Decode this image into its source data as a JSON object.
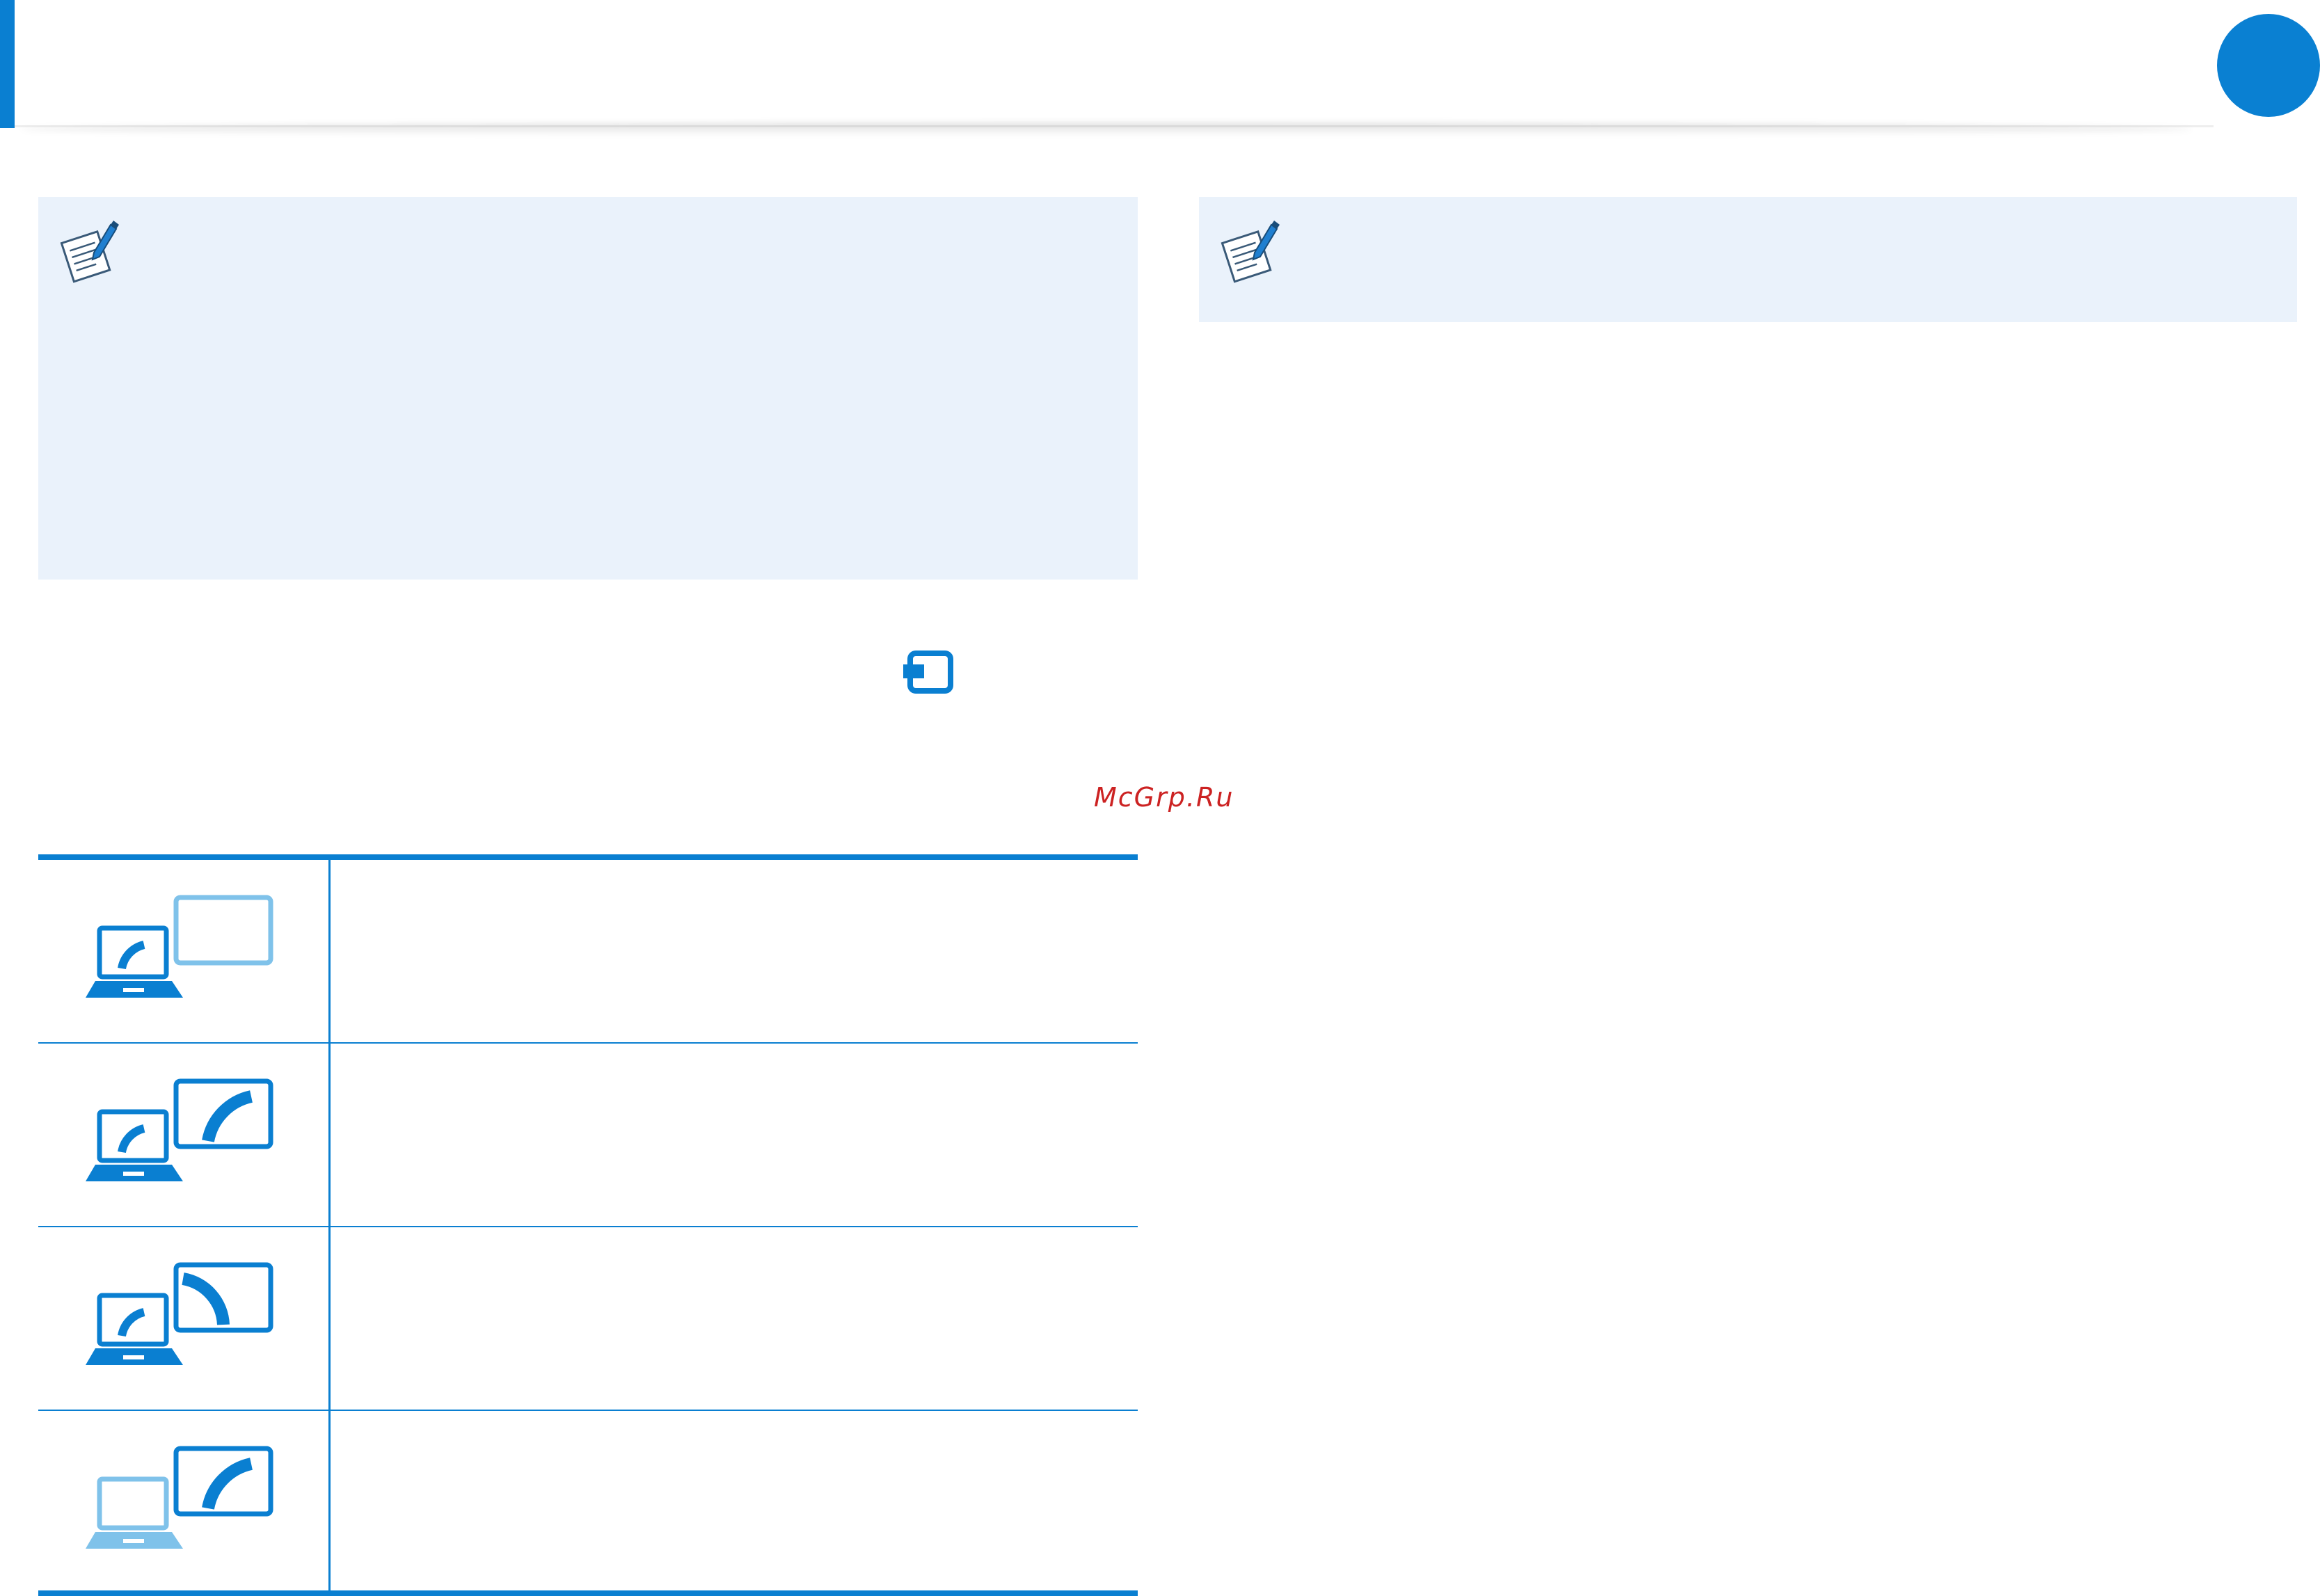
{
  "header": {
    "accent_color": "#0a7fd1",
    "chapter_badge_color": "#0a80d2"
  },
  "notes": [
    {
      "icon": "note-pencil-icon"
    },
    {
      "icon": "note-pencil-icon"
    }
  ],
  "inline_icons": {
    "display_switch": "display-switch-key-icon"
  },
  "watermark": "McGrp.Ru",
  "display_modes": [
    {
      "icon": "pc-screen-only-icon",
      "description": ""
    },
    {
      "icon": "duplicate-display-icon",
      "description": ""
    },
    {
      "icon": "extend-display-icon",
      "description": ""
    },
    {
      "icon": "second-screen-only-icon",
      "description": ""
    }
  ],
  "colors": {
    "primary_blue": "#0a7fd1",
    "light_blue": "#7fc2ea",
    "note_background": "#eaf2fb",
    "watermark_red": "#cc2222"
  }
}
